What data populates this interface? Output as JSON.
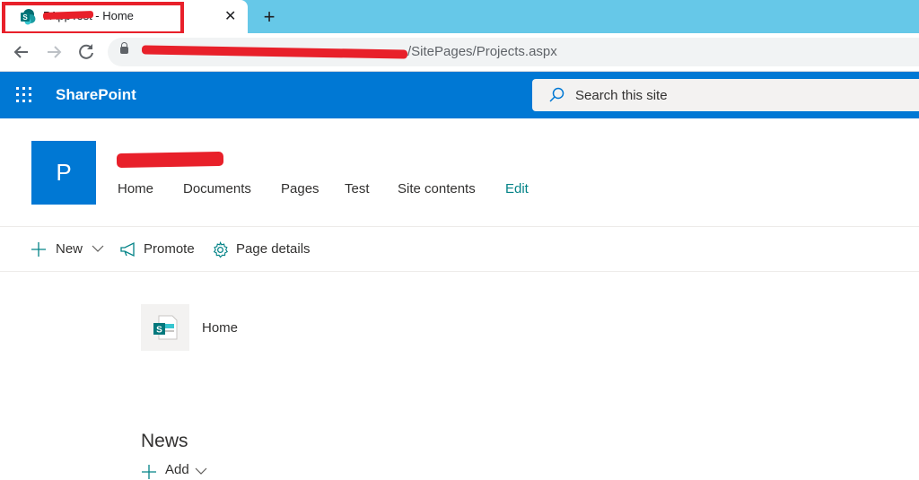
{
  "browser": {
    "tab_title": "PAppTest - Home",
    "new_tab_symbol": "+",
    "close_symbol": "✕",
    "url_suffix": "/SitePages/Projects.aspx"
  },
  "suite": {
    "brand": "SharePoint",
    "search_placeholder": "Search this site"
  },
  "site": {
    "logo_letter": "P",
    "nav": [
      "Home",
      "Documents",
      "Pages",
      "Test",
      "Site contents",
      "Edit"
    ]
  },
  "commands": {
    "new": "New",
    "promote": "Promote",
    "page_details": "Page details"
  },
  "content": {
    "page_name": "Home",
    "news_heading": "News",
    "news_add": "Add"
  },
  "colors": {
    "suite_bar": "#0078d4",
    "accent": "#038387",
    "redaction": "#e8202a",
    "tab_strip": "#66c8e8"
  }
}
